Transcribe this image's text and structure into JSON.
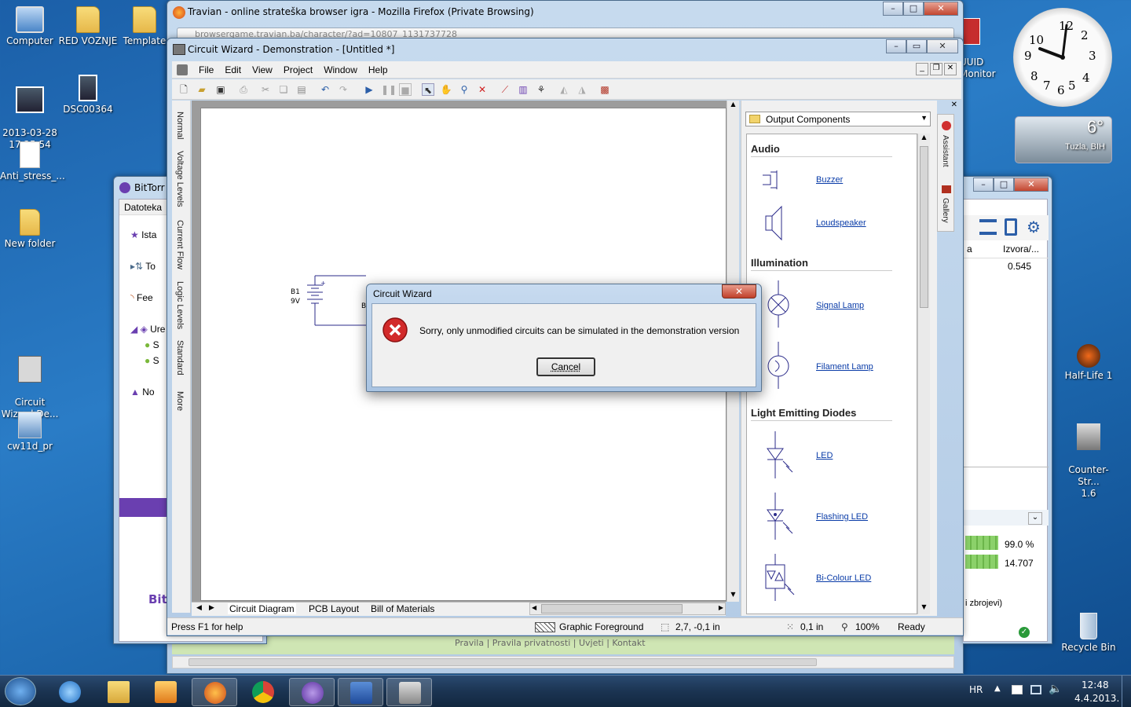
{
  "desktop": {
    "icons": [
      {
        "label": "Computer"
      },
      {
        "label": "RED VOZNJE"
      },
      {
        "label": "Template"
      },
      {
        "label": "2013-03-28\n17.25.54"
      },
      {
        "label": "DSC00364"
      },
      {
        "label": "Anti_stress_..."
      },
      {
        "label": "New folder"
      },
      {
        "label": "Circuit\nWizard De..."
      },
      {
        "label": "cw11d_pr"
      },
      {
        "label": "Half-Life 1"
      },
      {
        "label": "Counter-Str...\n1.6"
      },
      {
        "label": "Recycle Bin"
      },
      {
        "label": "UUID\nMonitor"
      }
    ],
    "clock_gadget": {
      "numbers": [
        "12",
        "1",
        "2",
        "3",
        "4",
        "5",
        "6",
        "7",
        "8",
        "9",
        "10",
        "11"
      ]
    },
    "weather_gadget": {
      "temp": "6°",
      "city": "Tuzla, BIH"
    }
  },
  "firefox": {
    "title": "Travian - online strateška browser igra - Mozilla Firefox (Private Browsing)",
    "url": "browsergame.travian.ba/character/?ad=10807_1131737728",
    "footer_text": "Pravila | Pravila privatnosti | Uvjeti | Kontakt"
  },
  "bittorrent": {
    "title": "BitTorr",
    "menu": "Datoteka",
    "items": [
      "Ista",
      "To",
      "Fee",
      "Ure",
      "S",
      "S",
      "No"
    ],
    "brand": "Bit",
    "columns": [
      "a",
      "Izvora/..."
    ],
    "row_value": "0.545",
    "stat1": "99.0 %",
    "stat2": "14.707",
    "note": "i zbrojevi)"
  },
  "cw": {
    "title": "Circuit Wizard - Demonstration - [Untitled *]",
    "menu": [
      "File",
      "Edit",
      "View",
      "Project",
      "Window",
      "Help"
    ],
    "side_tabs": [
      "Normal",
      "Voltage Levels",
      "Current Flow",
      "Logic Levels",
      "Standard",
      "More"
    ],
    "battery": {
      "name": "B1",
      "value": "9V",
      "partial": "B"
    },
    "bottom_tabs": [
      "Circuit Diagram",
      "PCB Layout",
      "Bill of Materials"
    ],
    "status": {
      "help": "Press F1 for help",
      "layer": "Graphic Foreground",
      "coords": "2,7, -0,1 in",
      "grid": "0,1 in",
      "zoom": "100%",
      "state": "Ready"
    },
    "panel": {
      "dropdown": "Output Components",
      "tabs": [
        "Assistant",
        "Gallery"
      ],
      "sections": [
        {
          "title": "Audio",
          "items": [
            "Buzzer",
            "Loudspeaker"
          ]
        },
        {
          "title": "Illumination",
          "items": [
            "Signal Lamp",
            "Filament Lamp"
          ]
        },
        {
          "title": "Light Emitting Diodes",
          "items": [
            "LED",
            "Flashing LED",
            "Bi-Colour LED"
          ]
        }
      ]
    }
  },
  "dialog": {
    "title": "Circuit Wizard",
    "message": "Sorry, only unmodified circuits can be simulated in the demonstration version",
    "button": "Cancel"
  },
  "taskbar": {
    "lang": "HR",
    "time": "12:48",
    "date": "4.4.2013."
  }
}
